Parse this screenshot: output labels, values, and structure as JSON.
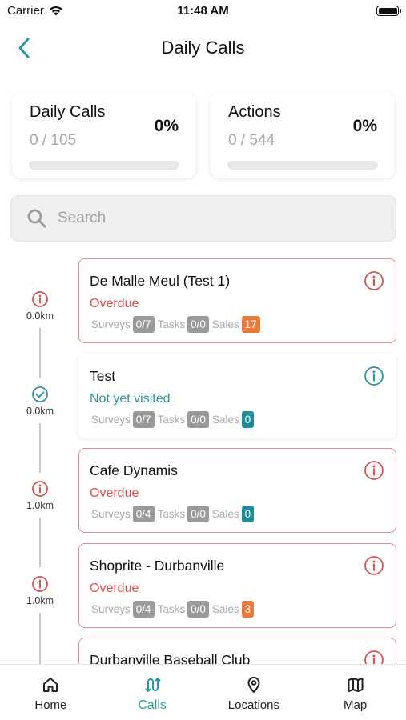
{
  "status_bar": {
    "carrier": "Carrier",
    "time": "11:48 AM"
  },
  "header": {
    "title": "Daily Calls",
    "back_icon": "chevron-left-icon"
  },
  "stats": [
    {
      "title": "Daily Calls",
      "value": "0 / 105",
      "percent": "0%",
      "progress": 0
    },
    {
      "title": "Actions",
      "value": "0 / 544",
      "percent": "0%",
      "progress": 0
    }
  ],
  "search": {
    "placeholder": "Search",
    "value": ""
  },
  "metric_labels": {
    "surveys": "Surveys",
    "tasks": "Tasks",
    "sales": "Sales"
  },
  "calls": [
    {
      "name": "De Malle Meul (Test 1)",
      "status": "Overdue",
      "state": "overdue",
      "distance": "0.0km",
      "surveys": "0/7",
      "tasks": "0/0",
      "sales": "17",
      "sales_color": "orange"
    },
    {
      "name": "Test",
      "status": "Not yet visited",
      "state": "pending",
      "distance": "0.0km",
      "surveys": "0/7",
      "tasks": "0/0",
      "sales": "0",
      "sales_color": "teal"
    },
    {
      "name": "Cafe Dynamis",
      "status": "Overdue",
      "state": "overdue",
      "distance": "1.0km",
      "surveys": "0/4",
      "tasks": "0/0",
      "sales": "0",
      "sales_color": "teal"
    },
    {
      "name": "Shoprite -  Durbanville",
      "status": "Overdue",
      "state": "overdue",
      "distance": "1.0km",
      "surveys": "0/4",
      "tasks": "0/0",
      "sales": "3",
      "sales_color": "orange"
    },
    {
      "name": "Durbanville Baseball Club",
      "status": "",
      "state": "overdue",
      "distance": "",
      "surveys": "",
      "tasks": "",
      "sales": "",
      "sales_color": ""
    }
  ],
  "tabs": [
    {
      "label": "Home",
      "icon": "home-icon",
      "active": false
    },
    {
      "label": "Calls",
      "icon": "route-icon",
      "active": true
    },
    {
      "label": "Locations",
      "icon": "map-pin-icon",
      "active": false
    },
    {
      "label": "Map",
      "icon": "map-icon",
      "active": false
    }
  ],
  "colors": {
    "accent": "#2a97a3",
    "overdue": "#d9534f",
    "badge_orange": "#e8793f",
    "badge_teal": "#1f8d9a",
    "badge_grey": "#9a9a9a"
  }
}
